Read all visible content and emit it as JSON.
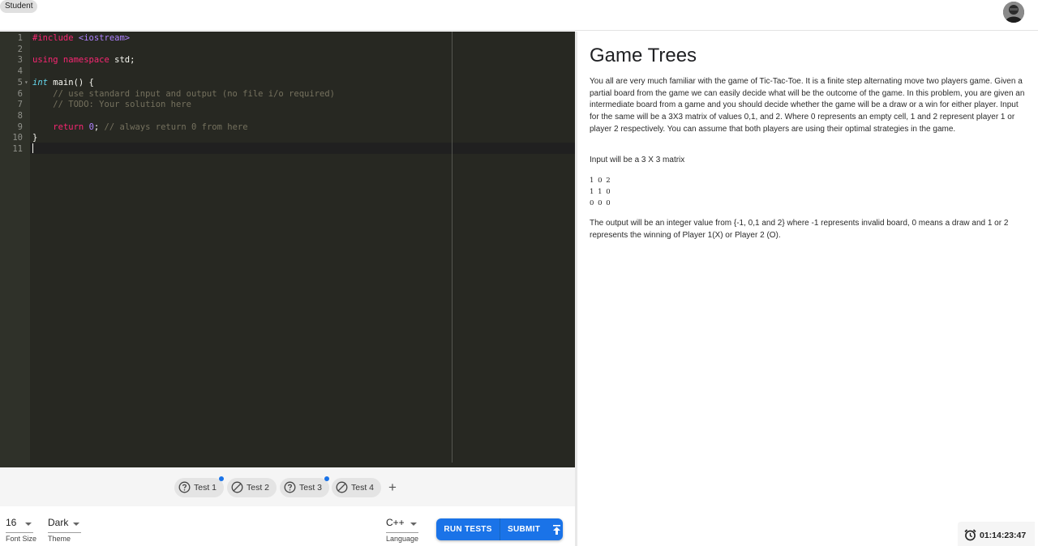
{
  "header": {
    "role_label": "Student",
    "avatar_icon": "user-avatar-icon"
  },
  "editor": {
    "lines": [
      {
        "n": "1",
        "parts": [
          {
            "t": "#include ",
            "c": "kw"
          },
          {
            "t": "<iostream>",
            "c": "str"
          }
        ]
      },
      {
        "n": "2",
        "parts": []
      },
      {
        "n": "3",
        "parts": [
          {
            "t": "using namespace",
            "c": "kw"
          },
          {
            "t": " std;",
            "c": ""
          }
        ]
      },
      {
        "n": "4",
        "parts": []
      },
      {
        "n": "5",
        "fold": true,
        "parts": [
          {
            "t": "int",
            "c": "ty"
          },
          {
            "t": " main() {",
            "c": ""
          }
        ]
      },
      {
        "n": "6",
        "parts": [
          {
            "t": "    // use standard input and output (no file i/o required)",
            "c": "cm"
          }
        ]
      },
      {
        "n": "7",
        "parts": [
          {
            "t": "    // TODO: Your solution here",
            "c": "cm"
          }
        ]
      },
      {
        "n": "8",
        "parts": []
      },
      {
        "n": "9",
        "parts": [
          {
            "t": "    ",
            "c": ""
          },
          {
            "t": "return",
            "c": "kw"
          },
          {
            "t": " ",
            "c": ""
          },
          {
            "t": "0",
            "c": "num"
          },
          {
            "t": "; ",
            "c": ""
          },
          {
            "t": "// always return 0 from here",
            "c": "cm"
          }
        ]
      },
      {
        "n": "10",
        "parts": [
          {
            "t": "}",
            "c": ""
          }
        ]
      },
      {
        "n": "11",
        "parts": []
      }
    ],
    "active_line": "11",
    "colors": {
      "background": "#272822",
      "gutter": "#2f3129",
      "keyword": "#f92672",
      "type": "#66d9ef",
      "string": "#ae81ff",
      "comment": "#75715e"
    }
  },
  "tests": [
    {
      "label": "Test 1",
      "icon": "question-circle-icon",
      "has_dot": true
    },
    {
      "label": "Test 2",
      "icon": "blocked-circle-icon",
      "has_dot": false
    },
    {
      "label": "Test 3",
      "icon": "question-circle-icon",
      "has_dot": true
    },
    {
      "label": "Test 4",
      "icon": "blocked-circle-icon",
      "has_dot": false
    }
  ],
  "add_test_label": "+",
  "settings": {
    "font_size": {
      "value": "16",
      "label": "Font Size"
    },
    "theme": {
      "value": "Dark",
      "label": "Theme"
    },
    "language": {
      "value": "C++",
      "label": "Language"
    }
  },
  "actions": {
    "run_tests": "RUN TESTS",
    "submit": "SUBMIT",
    "submit_icon": "upload-arrow-icon",
    "accent": "#1a73e8"
  },
  "problem": {
    "title": "Game Trees",
    "paragraph1": "You all are very much familiar with the game of Tic-Tac-Toe. It is a finite step alternating move two players game. Given a partial board from the game we can easily decide what will be the outcome of the game. In this problem, you are given an intermediate board from a game and you should decide whether the game will be a draw or a win for either player. Input for the same will be a 3X3 matrix of values 0,1, and 2. Where 0 represents an empty cell, 1 and 2 represent player 1 or player 2 respectively. You can assume that both players are using their optimal strategies in the game.",
    "paragraph2": "Input will be a 3 X 3 matrix",
    "matrix": [
      "1 0 2",
      "1 1 0",
      "0 0 0"
    ],
    "paragraph3": "The output will be an integer value from {-1, 0,1 and 2} where -1 represents invalid board, 0 means a draw and 1 or 2 represents the winning of Player 1(X) or Player 2 (O)."
  },
  "timer": {
    "value": "01:14:23:47",
    "icon": "alarm-clock-icon"
  }
}
